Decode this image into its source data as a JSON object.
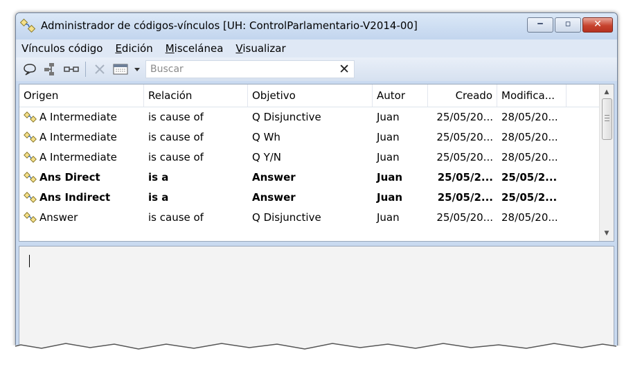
{
  "window": {
    "title": "Administrador de códigos-vínculos [UH: ControlParlamentario-V2014-00]",
    "buttons": {
      "minimize": "‒",
      "maximize": "▫",
      "close": "✕"
    },
    "accent_close": "#c7432e"
  },
  "menu": [
    {
      "label": "Vínculos código",
      "mnemonic_index": null
    },
    {
      "label": "Edición",
      "mnemonic_index": 0
    },
    {
      "label": "Miscelánea",
      "mnemonic_index": 0
    },
    {
      "label": "Visualizar",
      "mnemonic_index": 0
    }
  ],
  "toolbar": {
    "icons": [
      "comment-icon",
      "network-icon",
      "link-icon",
      "delete-icon",
      "view-icon",
      "dropdown-arrow-icon"
    ],
    "search_placeholder": "Buscar",
    "search_value": "",
    "clear_symbol": "✕"
  },
  "table": {
    "columns": [
      "Origen",
      "Relación",
      "Objetivo",
      "Autor",
      "Creado",
      "Modifica..."
    ],
    "rows": [
      {
        "origen": "A Intermediate",
        "relacion": "is cause of",
        "objetivo": "Q Disjunctive",
        "autor": "Juan",
        "creado": "25/05/20...",
        "modificado": "28/05/20...",
        "bold": false
      },
      {
        "origen": "A Intermediate",
        "relacion": "is cause of",
        "objetivo": "Q Wh",
        "autor": "Juan",
        "creado": "25/05/20...",
        "modificado": "28/05/20...",
        "bold": false
      },
      {
        "origen": "A Intermediate",
        "relacion": "is cause of",
        "objetivo": "Q Y/N",
        "autor": "Juan",
        "creado": "25/05/20...",
        "modificado": "28/05/20...",
        "bold": false
      },
      {
        "origen": "Ans Direct",
        "relacion": "is a",
        "objetivo": "Answer",
        "autor": "Juan",
        "creado": "25/05/2...",
        "modificado": "25/05/2...",
        "bold": true
      },
      {
        "origen": "Ans Indirect",
        "relacion": "is a",
        "objetivo": "Answer",
        "autor": "Juan",
        "creado": "25/05/2...",
        "modificado": "25/05/2...",
        "bold": true
      },
      {
        "origen": "Answer",
        "relacion": "is cause of",
        "objetivo": "Q Disjunctive",
        "autor": "Juan",
        "creado": "25/05/20...",
        "modificado": "28/05/20...",
        "bold": false
      }
    ]
  },
  "editor": {
    "text": ""
  }
}
